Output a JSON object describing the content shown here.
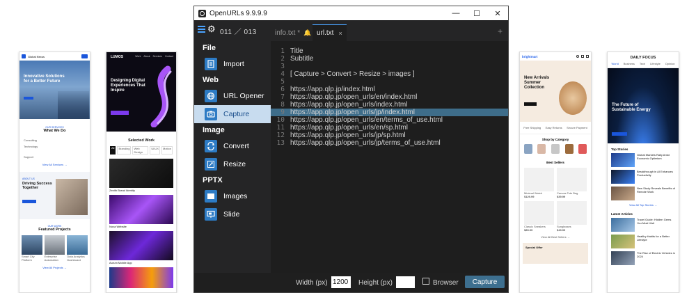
{
  "window": {
    "title": "OpenURLs 9.9.9.9",
    "minimize": "—",
    "maximize": "☐",
    "close": "✕"
  },
  "toolbar": {
    "counter": "011 ／ 013",
    "tabs": [
      {
        "label": "info.txt *"
      },
      {
        "label": "url.txt"
      }
    ],
    "close_glyph": "×",
    "add_glyph": "+",
    "bell_glyph": "🔔",
    "gear_glyph": "⚙"
  },
  "sidebar": {
    "sections": [
      {
        "title": "File",
        "items": [
          {
            "label": "Import"
          }
        ]
      },
      {
        "title": "Web",
        "items": [
          {
            "label": "URL Opener"
          },
          {
            "label": "Capture"
          }
        ]
      },
      {
        "title": "Image",
        "items": [
          {
            "label": "Convert"
          },
          {
            "label": "Resize"
          }
        ]
      },
      {
        "title": "PPTX",
        "items": [
          {
            "label": "Images"
          },
          {
            "label": "Slide"
          }
        ]
      }
    ],
    "active_item": "Capture"
  },
  "editor": {
    "highlight_line": 9,
    "lines": [
      {
        "n": "1",
        "text": "Title"
      },
      {
        "n": "2",
        "text": "Subtitle"
      },
      {
        "n": "3",
        "text": ""
      },
      {
        "n": "4",
        "text": "[ Capture > Convert > Resize > images ]"
      },
      {
        "n": "5",
        "text": ""
      },
      {
        "n": "6",
        "text": "https://app.qlp.jp/index.html"
      },
      {
        "n": "7",
        "text": "https://app.qlp.jp/open_urls/en/index.html"
      },
      {
        "n": "8",
        "text": "https://app.qlp.jp/open_urls/index.html"
      },
      {
        "n": "9",
        "text": "https://app.qlp.jp/open_urls/jp/index.html"
      },
      {
        "n": "10",
        "text": "https://app.qlp.jp/open_urls/en/terms_of_use.html"
      },
      {
        "n": "11",
        "text": "https://app.qlp.jp/open_urls/en/sp.html"
      },
      {
        "n": "12",
        "text": "https://app.qlp.jp/open_urls/jp/sp.html"
      },
      {
        "n": "13",
        "text": "https://app.qlp.jp/open_urls/jp/terms_of_use.html"
      }
    ]
  },
  "statusbar": {
    "width_label": "Width (px)",
    "width_value": "1200",
    "height_label": "Height (px)",
    "height_value": "",
    "browser_label": "Browser",
    "capture_label": "Capture"
  },
  "thumbnails": {
    "t1": {
      "nav_brand": "Global Nexus",
      "hero_title": "Innovative Solutions for a Better Future",
      "section_tag": "OUR SERVICES",
      "section_title": "What We Do",
      "services": [
        "Consulting",
        "Technology",
        "Support"
      ],
      "view_all": "View All Services →",
      "about_tag": "ABOUT US",
      "about_title": "Driving Success Together",
      "projects_tag": "OUR WORK",
      "projects_title": "Featured Projects",
      "projects": [
        "Smart City Platform",
        "Enterprise Automation",
        "Data Analytics Dashboard"
      ],
      "view_projects": "View All Projects →"
    },
    "t2": {
      "brand": "LUMOS",
      "nav": [
        "Work",
        "About",
        "Services",
        "Contact"
      ],
      "hero_title": "Designing Digital Experiences That Inspire",
      "section_title": "Selected Work",
      "filters": [
        "All",
        "Branding",
        "Web Design",
        "UI/UX",
        "Motion"
      ],
      "works": [
        "Zenith Brand Identity",
        "Nova Website",
        "Aurum Mobile App"
      ]
    },
    "t3": {
      "brand": "brightmart",
      "hero_title": "New Arrivals Summer Collection",
      "cta": "Shop Now",
      "perks": [
        "Free Shipping",
        "Easy Returns",
        "Secure Payment"
      ],
      "category_title": "Shop by Category",
      "categories": [
        "Men",
        "Women",
        "Shoes",
        "Accessories",
        "Sale"
      ],
      "best_title": "Best Sellers",
      "products": [
        {
          "name": "Minimal Watch",
          "price": "$129.99"
        },
        {
          "name": "Canvas Tote Bag",
          "price": "$39.99"
        },
        {
          "name": "Classic Sneakers",
          "price": "$89.99"
        },
        {
          "name": "Sunglasses",
          "price": "$49.99"
        }
      ],
      "view_all": "View All Best Sellers →",
      "offer": "Special Offer"
    },
    "t4": {
      "brand": "DAILY FOCUS",
      "nav": [
        "World",
        "Business",
        "Tech",
        "Lifestyle",
        "Opinion"
      ],
      "hero_title": "The Future of Sustainable Energy",
      "cta": "Read More",
      "top_title": "Top Stories",
      "stories": [
        "Global Markets Rally Amid Economic Optimism",
        "Breakthrough in AI Enhances Productivity",
        "New Study Reveals Benefits of Remote Work"
      ],
      "view_top": "View All Top Stories →",
      "latest_title": "Latest Articles",
      "articles": [
        "Travel Guide: Hidden Gems You Must Visit",
        "Healthy Habits for a Better Lifestyle",
        "The Rise of Electric Vehicles in 2024"
      ]
    }
  }
}
